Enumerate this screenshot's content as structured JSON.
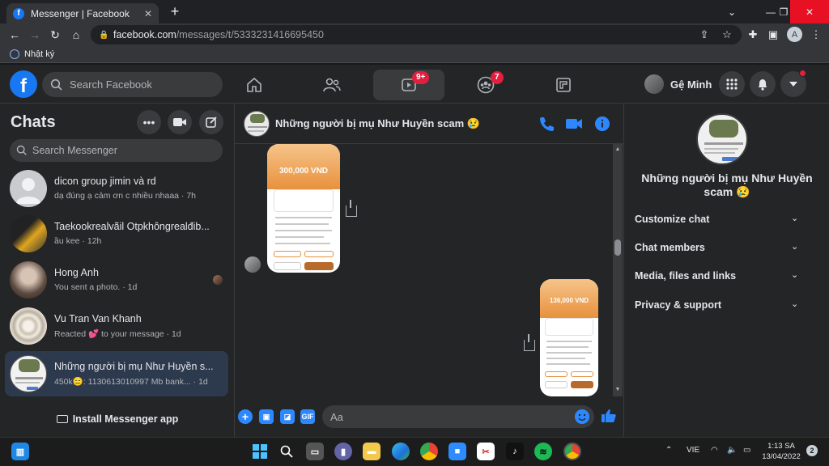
{
  "browser": {
    "tab_title": "Messenger | Facebook",
    "tab_close": "✕",
    "new_tab": "+",
    "url_host": "facebook.com",
    "url_path": "/messages/t/5333231416695450",
    "profile_initial": "A",
    "bookmark_label": "Nhật ký",
    "window_minimize": "—",
    "window_restore": "❐",
    "window_close": "✕"
  },
  "fb_header": {
    "logo": "f",
    "search_placeholder": "Search Facebook",
    "watch_badge": "9+",
    "groups_badge": "7",
    "profile_name": "Gệ Minh"
  },
  "left_panel": {
    "title": "Chats",
    "search_placeholder": "Search Messenger",
    "install_label": "Install Messenger app",
    "chats": [
      {
        "name": "dicon group jimin và rd",
        "meta": "dạ đúng ạ cảm ơn c nhiều nhaaa · 7h"
      },
      {
        "name": "Taekookrealvãil Otpkhôngrealđib...",
        "meta": "ầu kee · 12h"
      },
      {
        "name": "Hong Anh",
        "meta": "You sent a photo. · 1d"
      },
      {
        "name": "Vu Tran Van Khanh",
        "meta": "Reacted 💕 to your message · 1d"
      },
      {
        "name": "Những người bị mụ Như Huyền s...",
        "meta": "450k😑: 1130613010997 Mb bank... · 1d"
      }
    ]
  },
  "conversation": {
    "title": "Những người bị mụ Như Huyền scam 😢",
    "receipt1_amount": "300,000 VND",
    "receipt2_amount": "136,000 VND",
    "composer_placeholder": "Aa",
    "gif_label": "GIF"
  },
  "right_panel": {
    "name": "Những người bị mụ Như Huyền scam 😢",
    "items": [
      {
        "label": "Customize chat"
      },
      {
        "label": "Chat members"
      },
      {
        "label": "Media, files and links"
      },
      {
        "label": "Privacy & support"
      }
    ]
  },
  "taskbar": {
    "lang": "VIE",
    "time": "1:13 SA",
    "date": "13/04/2022",
    "notifications": "2"
  },
  "colors": {
    "accent": "#2d88ff",
    "badge": "#e41e3f",
    "panel": "#242526",
    "selected_chat": "#2d3a4d"
  }
}
